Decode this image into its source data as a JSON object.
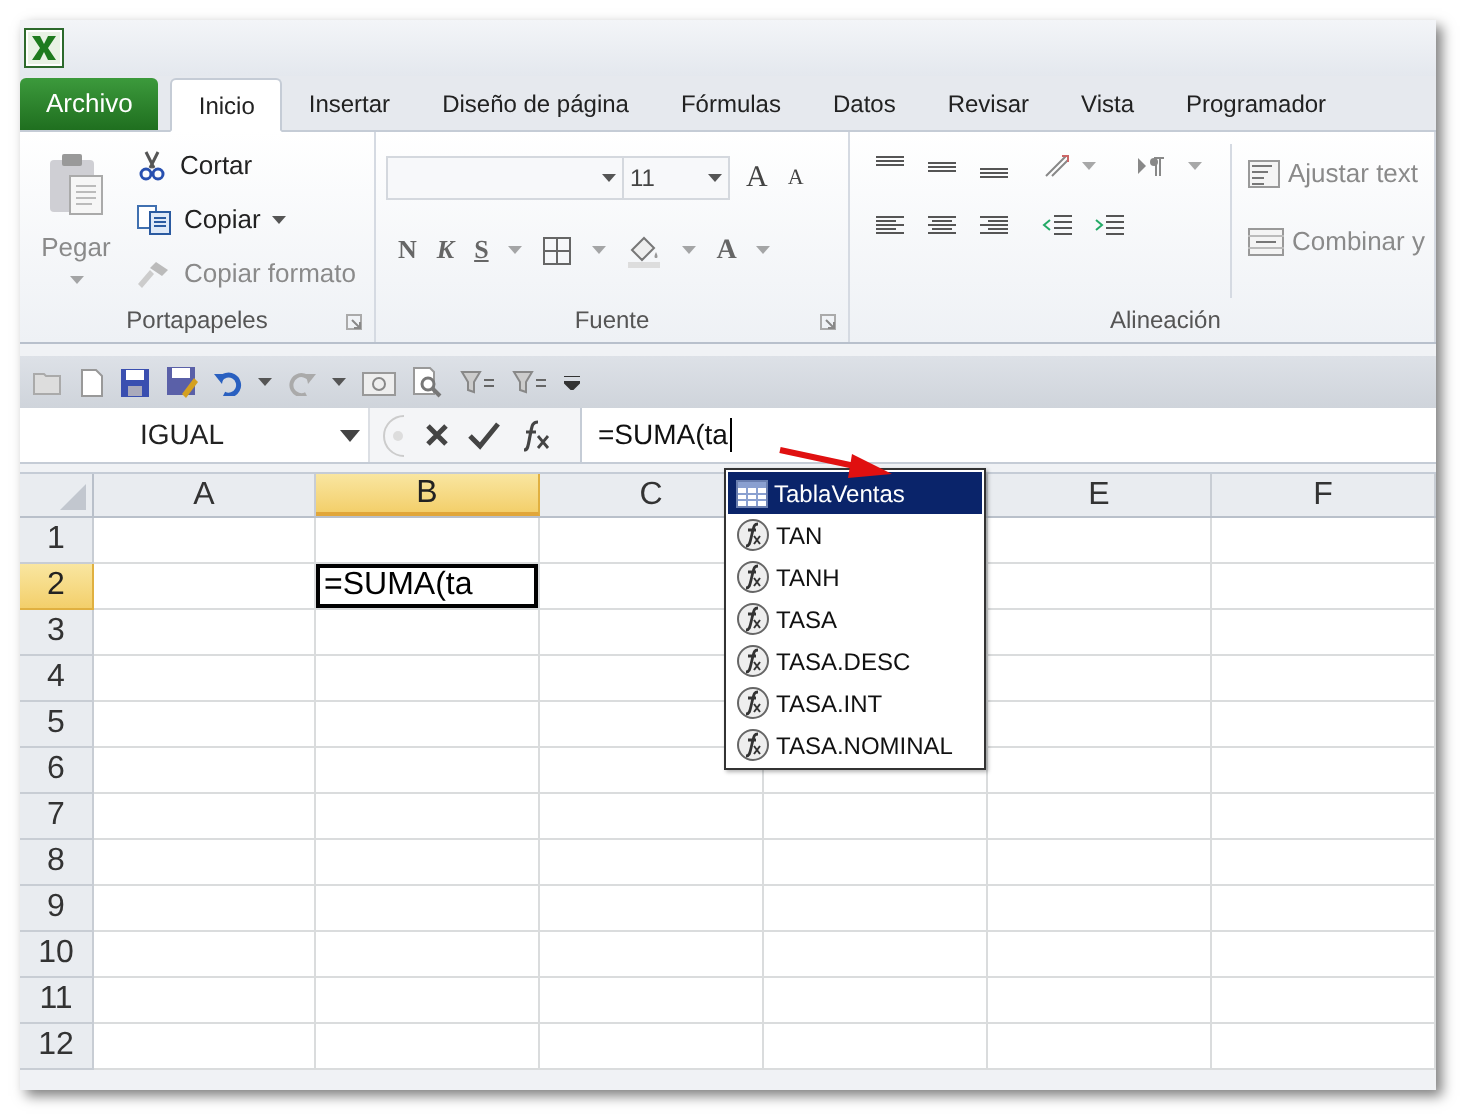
{
  "tabs": [
    {
      "label": "Archivo",
      "kind": "file",
      "selected": false
    },
    {
      "label": "Inicio",
      "kind": "tab",
      "selected": true
    },
    {
      "label": "Insertar",
      "kind": "tab",
      "selected": false
    },
    {
      "label": "Diseño de página",
      "kind": "tab",
      "selected": false
    },
    {
      "label": "Fórmulas",
      "kind": "tab",
      "selected": false
    },
    {
      "label": "Datos",
      "kind": "tab",
      "selected": false
    },
    {
      "label": "Revisar",
      "kind": "tab",
      "selected": false
    },
    {
      "label": "Vista",
      "kind": "tab",
      "selected": false
    },
    {
      "label": "Programador",
      "kind": "tab",
      "selected": false
    }
  ],
  "ribbon": {
    "clipboard": {
      "title": "Portapapeles",
      "paste": {
        "label": "Pegar",
        "disabled": true
      },
      "items": [
        {
          "label": "Cortar",
          "disabled": false,
          "has_menu": false
        },
        {
          "label": "Copiar",
          "disabled": false,
          "has_menu": true
        },
        {
          "label": "Copiar formato",
          "disabled": true,
          "has_menu": false
        }
      ]
    },
    "font": {
      "title": "Fuente",
      "size": "11",
      "grow": "A",
      "shrink": "A",
      "styles": [
        "N",
        "K",
        "S"
      ],
      "color_letter": "A"
    },
    "alignment": {
      "title": "Alineación",
      "wrap": {
        "label": "Ajustar text",
        "disabled": true
      },
      "merge": {
        "label": "Combinar y",
        "disabled": true
      }
    }
  },
  "formula_bar": {
    "name_box": "IGUAL",
    "formula": "=SUMA(ta"
  },
  "sheet": {
    "columns": [
      {
        "label": "A",
        "selected": false
      },
      {
        "label": "B",
        "selected": true
      },
      {
        "label": "C",
        "selected": false
      },
      {
        "selected": false
      },
      {
        "label": "E",
        "selected": false
      },
      {
        "label": "F",
        "selected": false
      }
    ],
    "rows": [
      {
        "label": "1",
        "selected": false
      },
      {
        "label": "2",
        "selected": true
      },
      {
        "label": "3",
        "selected": false
      },
      {
        "label": "4",
        "selected": false
      },
      {
        "label": "5",
        "selected": false
      },
      {
        "label": "6",
        "selected": false
      },
      {
        "label": "7",
        "selected": false
      },
      {
        "label": "8",
        "selected": false
      },
      {
        "label": "9",
        "selected": false
      },
      {
        "label": "10",
        "selected": false
      },
      {
        "label": "11",
        "selected": false
      },
      {
        "label": "12",
        "selected": false
      }
    ],
    "active_cell": {
      "text": "=SUMA(ta"
    }
  },
  "autocomplete": [
    {
      "label": "TablaVentas",
      "kind": "table",
      "selected": true
    },
    {
      "label": "TAN",
      "kind": "function",
      "selected": false
    },
    {
      "label": "TANH",
      "kind": "function",
      "selected": false
    },
    {
      "label": "TASA",
      "kind": "function",
      "selected": false
    },
    {
      "label": "TASA.DESC",
      "kind": "function",
      "selected": false
    },
    {
      "label": "TASA.INT",
      "kind": "function",
      "selected": false
    },
    {
      "label": "TASA.NOMINAL",
      "kind": "function",
      "selected": false
    }
  ]
}
